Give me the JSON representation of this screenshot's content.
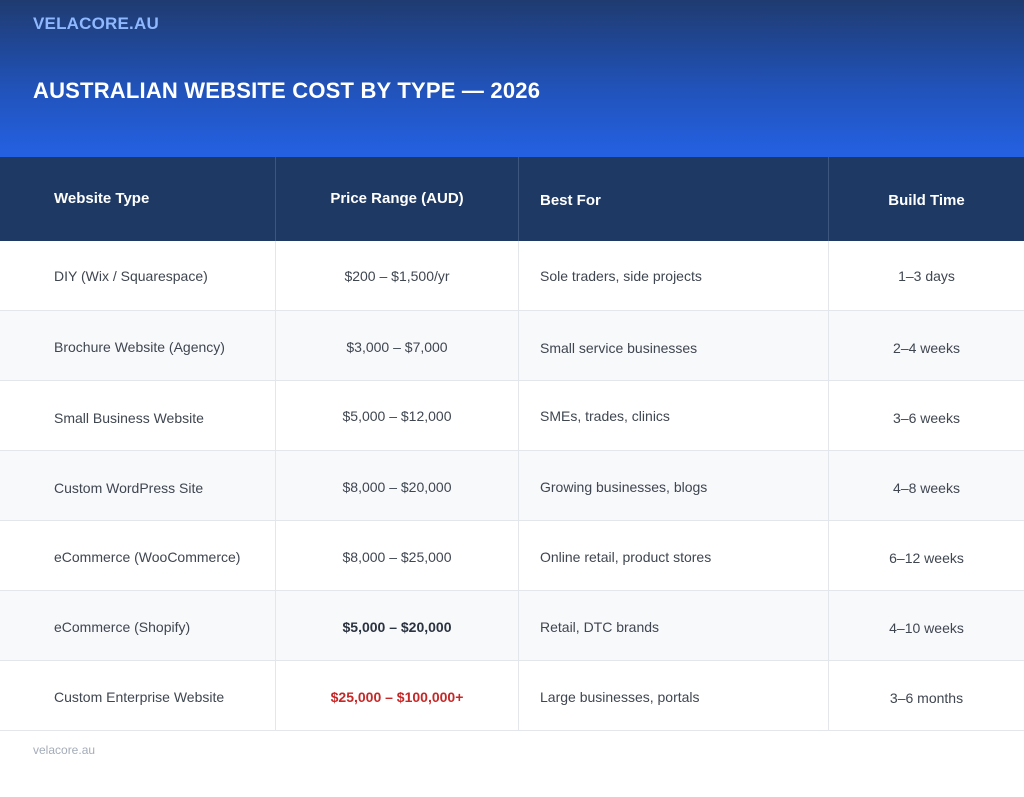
{
  "header": {
    "brand": "VELACORE.AU",
    "title": "AUSTRALIAN WEBSITE COST BY TYPE — 2026",
    "colors": {
      "banner_top": "#1f3b70",
      "banner_bottom": "#2461e3",
      "brand": "#8fb8ff",
      "header_row": "#1e3a64",
      "highlight_red": "#c62828"
    }
  },
  "table": {
    "columns": [
      "Website Type",
      "Price Range (AUD)",
      "Best For",
      "Build Time"
    ],
    "rows": [
      {
        "type": "DIY (Wix / Squarespace)",
        "price": "$200 – $1,500/yr",
        "best_for": "Sole traders, side projects",
        "build_time": "1–3 days"
      },
      {
        "type": "Brochure Website (Agency)",
        "price": "$3,000 – $7,000",
        "best_for": "Small service businesses",
        "build_time": "2–4 weeks"
      },
      {
        "type": "Small Business Website",
        "price": "$5,000 – $12,000",
        "best_for": "SMEs, trades, clinics",
        "build_time": "3–6 weeks"
      },
      {
        "type": "Custom WordPress Site",
        "price": "$8,000 – $20,000",
        "best_for": "Growing businesses, blogs",
        "build_time": "4–8 weeks"
      },
      {
        "type": "eCommerce (WooCommerce)",
        "price": "$8,000 – $25,000",
        "best_for": "Online retail, product stores",
        "build_time": "6–12 weeks"
      },
      {
        "type": "eCommerce (Shopify)",
        "price": "$5,000 – $20,000",
        "best_for": "Retail, DTC brands",
        "build_time": "4–10 weeks"
      },
      {
        "type": "Custom Enterprise Website",
        "price": "$25,000 – $100,000+",
        "best_for": "Large businesses, portals",
        "build_time": "3–6 months"
      }
    ]
  },
  "footer": {
    "text": "velacore.au"
  }
}
